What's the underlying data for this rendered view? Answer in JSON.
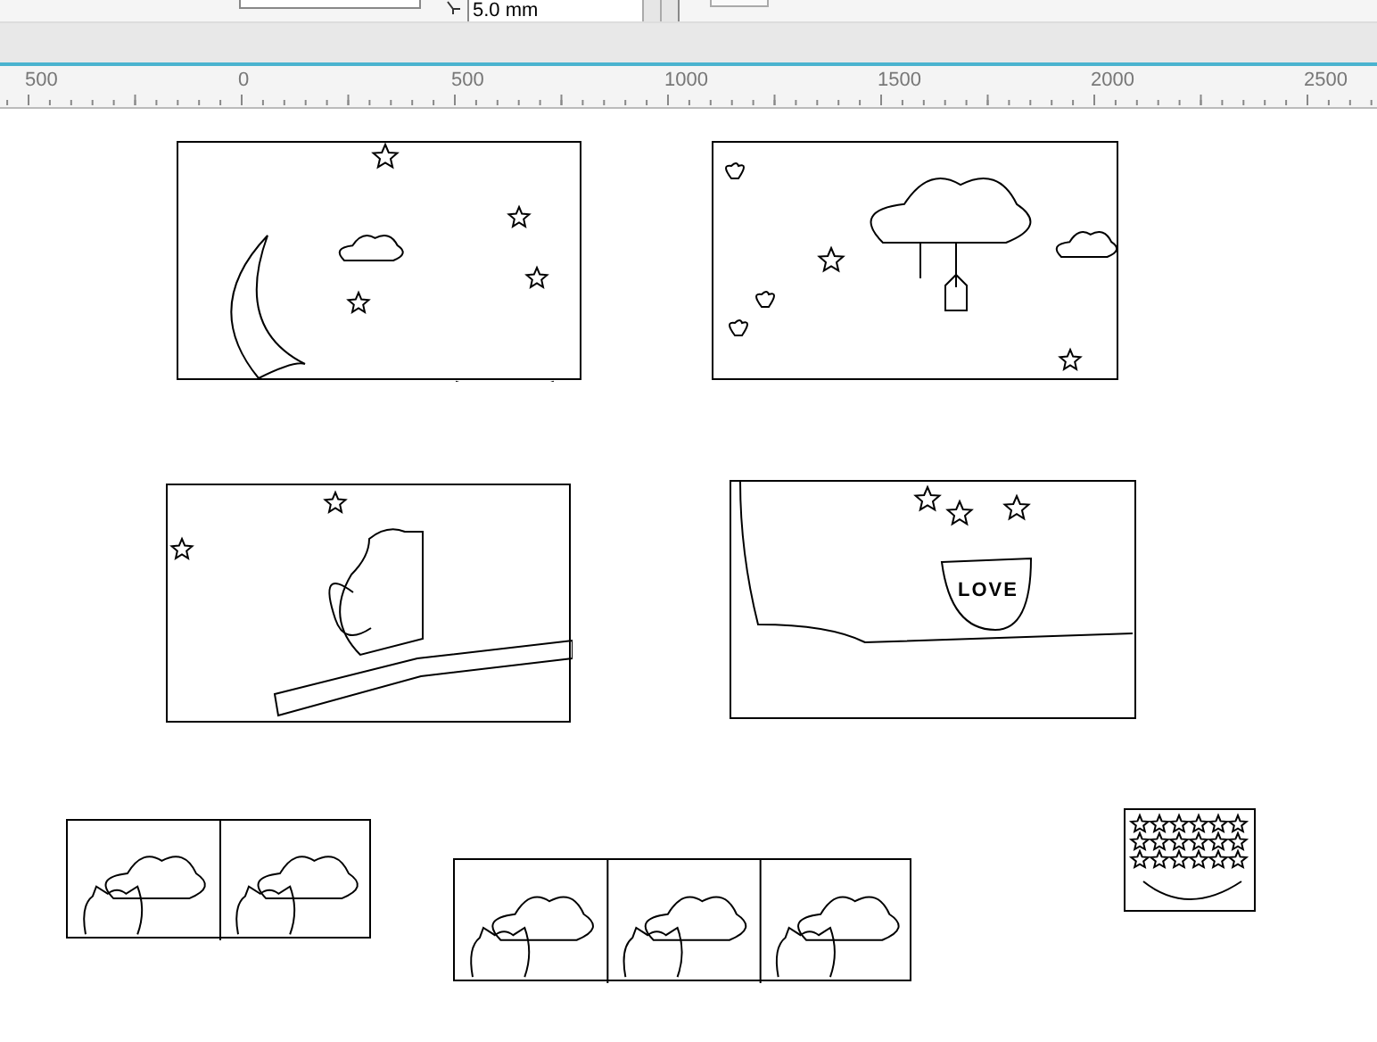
{
  "toolbar": {
    "offset_field": {
      "value": "5.0 mm"
    }
  },
  "ruler": {
    "labels": [
      "500",
      "0",
      "500",
      "1000",
      "1500",
      "2000",
      "2500"
    ]
  },
  "canvas": {
    "pages": [
      {
        "kind": "night"
      },
      {
        "kind": "cloud"
      },
      {
        "kind": "branch"
      },
      {
        "kind": "flowers",
        "text": "LOVE"
      },
      {
        "kind": "pair"
      },
      {
        "kind": "triple"
      },
      {
        "kind": "stars"
      }
    ]
  }
}
